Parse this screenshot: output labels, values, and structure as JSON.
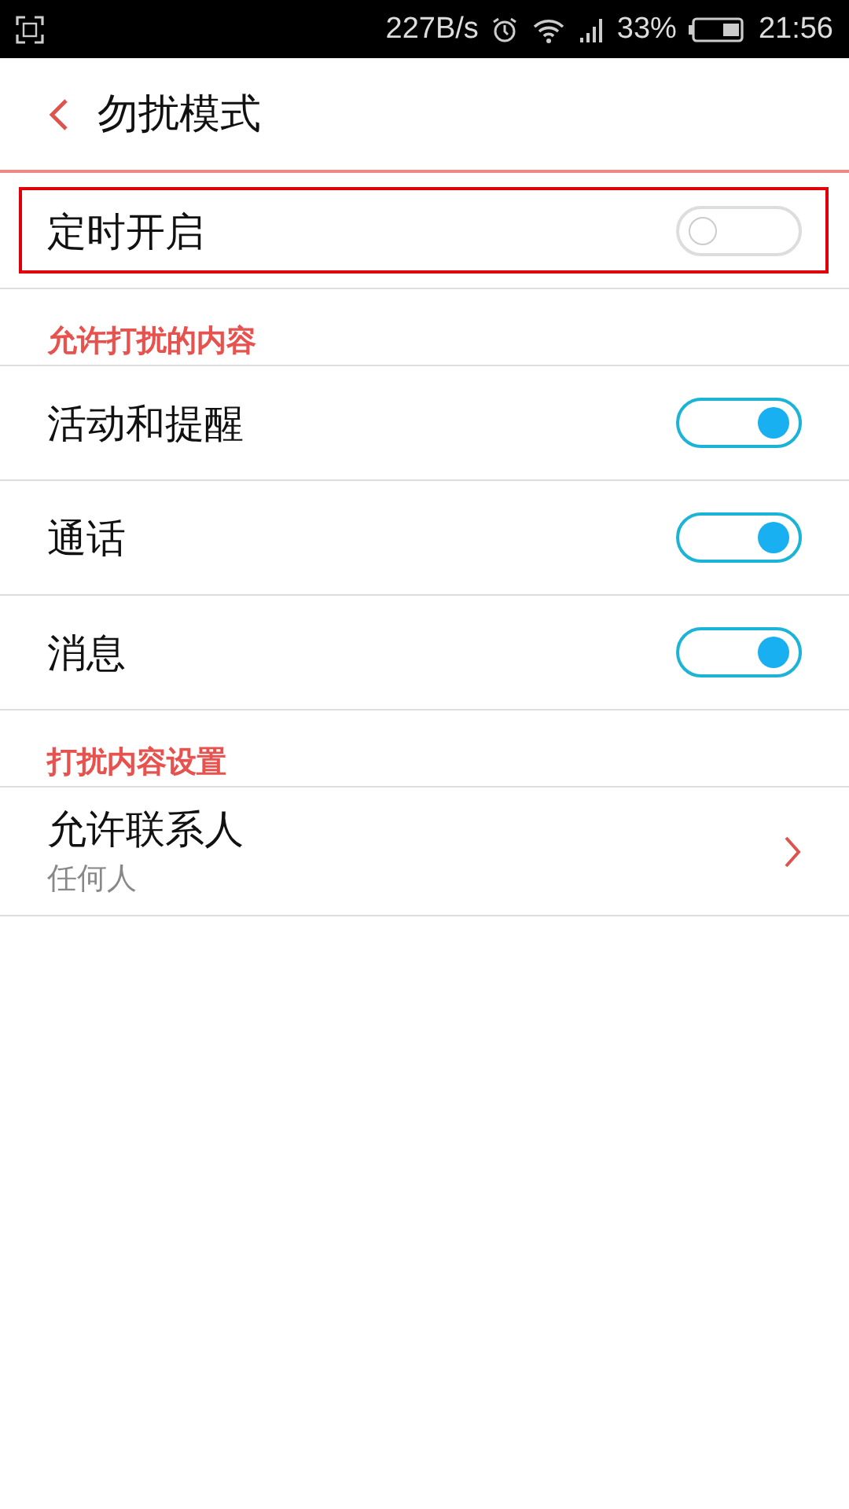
{
  "status_bar": {
    "speed": "227B/s",
    "battery_percent": "33%",
    "time": "21:56"
  },
  "header": {
    "title": "勿扰模式"
  },
  "schedule": {
    "label": "定时开启",
    "on": false,
    "highlighted": true
  },
  "sections": [
    {
      "title": "允许打扰的内容",
      "items": [
        {
          "kind": "toggle",
          "label": "活动和提醒",
          "on": true
        },
        {
          "kind": "toggle",
          "label": "通话",
          "on": true
        },
        {
          "kind": "toggle",
          "label": "消息",
          "on": true
        }
      ]
    },
    {
      "title": "打扰内容设置",
      "items": [
        {
          "kind": "link",
          "label": "允许联系人",
          "value": "任何人"
        }
      ]
    }
  ]
}
